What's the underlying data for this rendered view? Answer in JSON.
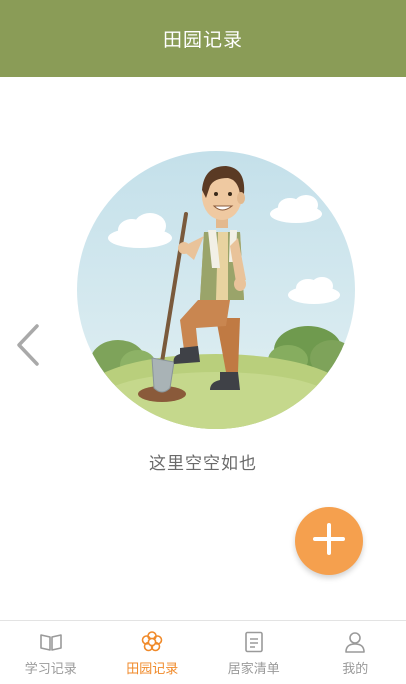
{
  "header": {
    "title": "田园记录"
  },
  "navigation": {
    "back_icon": "chevron-left-icon"
  },
  "empty_state": {
    "message": "这里空空如也",
    "illustration": "farmer-with-shovel-illustration"
  },
  "fab": {
    "icon": "plus-icon",
    "color": "#f5a04e"
  },
  "tabbar": {
    "active_color": "#f08a2a",
    "inactive_color": "#9a9a9a",
    "items": [
      {
        "label": "学习记录",
        "icon": "book-icon",
        "active": false
      },
      {
        "label": "田园记录",
        "icon": "flower-icon",
        "active": true
      },
      {
        "label": "居家清单",
        "icon": "list-document-icon",
        "active": false
      },
      {
        "label": "我的",
        "icon": "user-icon",
        "active": false
      }
    ]
  },
  "colors": {
    "header_bg": "#8a9c57",
    "accent": "#f5a04e"
  }
}
